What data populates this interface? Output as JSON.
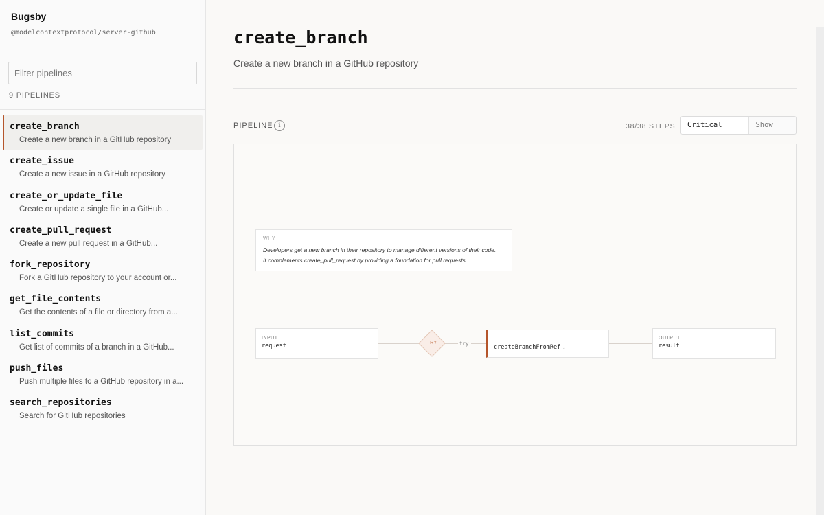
{
  "app": {
    "name": "Bugsby",
    "package": "@modelcontextprotocol/server-github"
  },
  "sidebar": {
    "filter_placeholder": "Filter pipelines",
    "count_label": "9 PIPELINES",
    "items": [
      {
        "name": "create_branch",
        "desc": "Create a new branch in a GitHub repository",
        "active": true
      },
      {
        "name": "create_issue",
        "desc": "Create a new issue in a GitHub repository"
      },
      {
        "name": "create_or_update_file",
        "desc": "Create or update a single file in a GitHub..."
      },
      {
        "name": "create_pull_request",
        "desc": "Create a new pull request in a GitHub..."
      },
      {
        "name": "fork_repository",
        "desc": "Fork a GitHub repository to your account or..."
      },
      {
        "name": "get_file_contents",
        "desc": "Get the contents of a file or directory from a..."
      },
      {
        "name": "list_commits",
        "desc": "Get list of commits of a branch in a GitHub..."
      },
      {
        "name": "push_files",
        "desc": "Push multiple files to a GitHub repository in a..."
      },
      {
        "name": "search_repositories",
        "desc": "Search for GitHub repositories"
      }
    ]
  },
  "main": {
    "title": "create_branch",
    "subtitle": "Create a new branch in a GitHub repository",
    "pipeline_label": "PIPELINE",
    "info_glyph": "i",
    "steps_label": "38/38 STEPS",
    "toggle": {
      "critical": "Critical only",
      "all": "Show all"
    },
    "why": {
      "label": "WHY",
      "line1": "Developers get a new branch in their repository to manage different versions of their code.",
      "line2": "It complements create_pull_request by providing a foundation for pull requests."
    },
    "input": {
      "label": "INPUT",
      "value": "request"
    },
    "try": {
      "label": "TRY",
      "edge": "try"
    },
    "function": {
      "name": "createBranchFromRef",
      "arrow": "↓"
    },
    "output": {
      "label": "OUTPUT",
      "value": "result"
    }
  },
  "colors": {
    "accent": "#b5552b",
    "background": "#faf9f7"
  }
}
